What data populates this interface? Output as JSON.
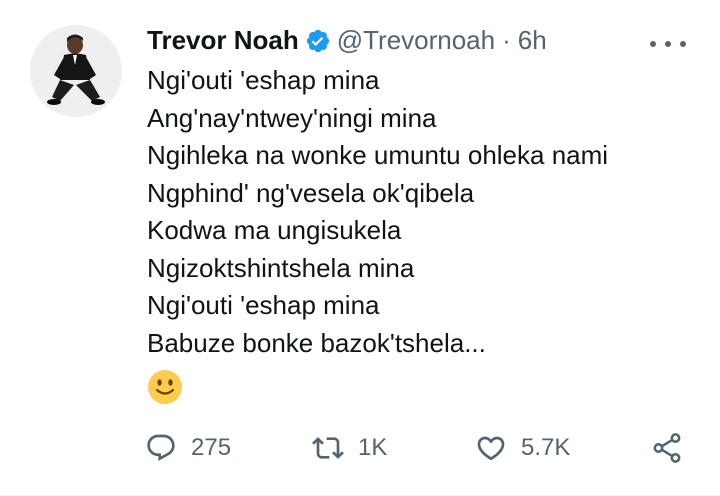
{
  "tweet": {
    "author_name": "Trevor Noah",
    "handle": "@Trevornoah",
    "separator": "·",
    "timestamp": "6h",
    "verified": true,
    "accent_color": "#1d9bf0",
    "lines": [
      "Ngi'outi 'eshap mina",
      "Ang'nay'ntwey'ningi mina",
      "Ngihleka na wonke umuntu ohleka nami",
      "Ngphind' ng'vesela ok'qibela",
      "Kodwa ma ungisukela",
      "Ngizoktshintshela mina",
      "Ngi'outi 'eshap mina",
      "Babuze bonke bazok'tshela..."
    ],
    "emoji": "slightly-smiling-face"
  },
  "actions": {
    "reply_count": "275",
    "retweet_count": "1K",
    "like_count": "5.7K"
  }
}
